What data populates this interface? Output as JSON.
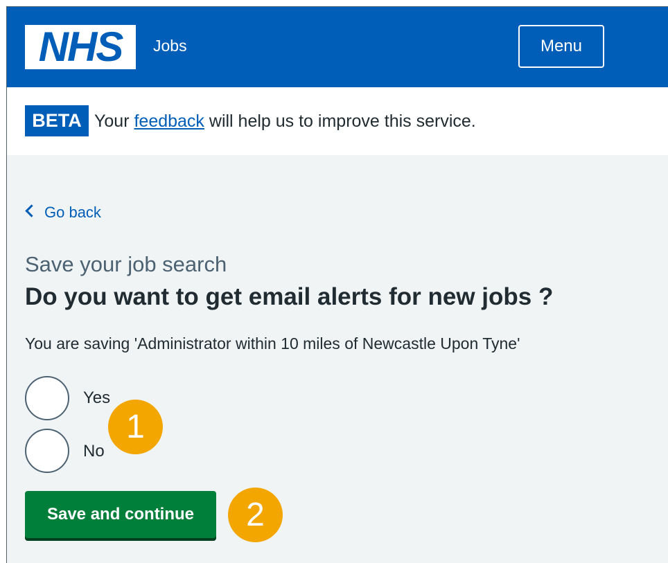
{
  "header": {
    "logo_text": "NHS",
    "service_name": "Jobs",
    "menu_label": "Menu"
  },
  "beta_banner": {
    "tag": "BETA",
    "text_before": "Your",
    "link_text": "feedback",
    "text_after": "will help us to improve this service."
  },
  "back_link": {
    "label": "Go back"
  },
  "form": {
    "caption": "Save your job search",
    "question": "Do you want to get email alerts for new jobs ?",
    "hint": "You are saving 'Administrator within 10 miles of Newcastle Upon Tyne'",
    "options": [
      {
        "label": "Yes",
        "selected": false
      },
      {
        "label": "No",
        "selected": false
      }
    ],
    "submit_label": "Save and continue"
  },
  "callouts": [
    "1",
    "2"
  ],
  "colors": {
    "nhs_blue": "#005eb8",
    "button_green": "#007f3b",
    "callout_orange": "#f3a600",
    "page_background": "#f0f4f5"
  }
}
